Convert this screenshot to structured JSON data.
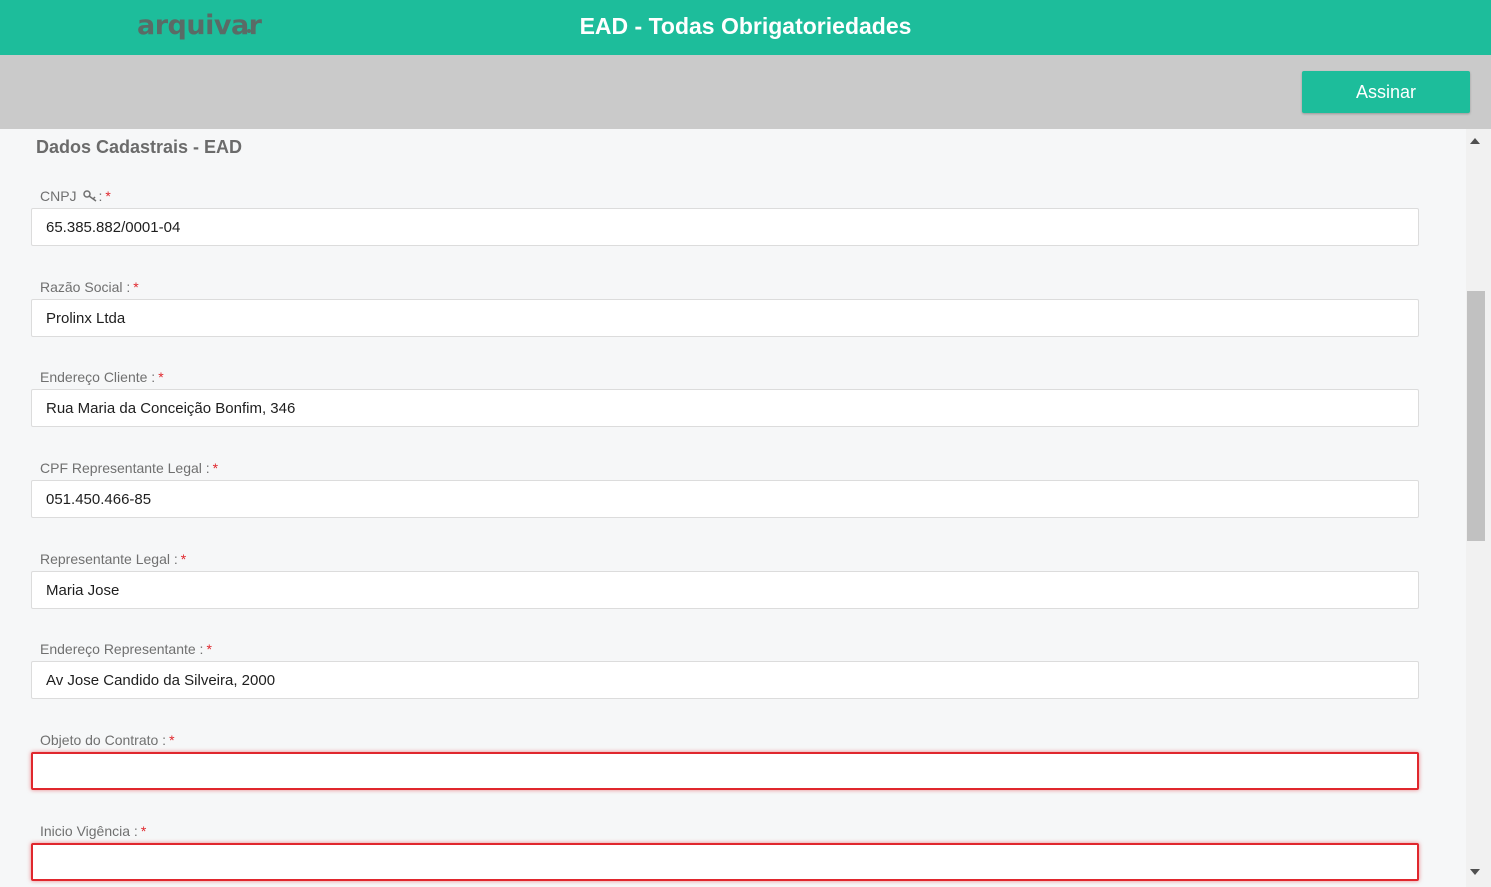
{
  "header": {
    "logo_text": "arquivar",
    "title": "EAD - Todas Obrigatoriedades",
    "colors": {
      "primary": "#1dbd9b",
      "logo": "#5a6b66",
      "error": "#e0272d"
    }
  },
  "toolbar": {
    "sign_label": "Assinar"
  },
  "form": {
    "section_title": "Dados Cadastrais - EAD",
    "required_mark": "*",
    "fields": [
      {
        "label": "CNPJ",
        "suffix": ":",
        "value": "65.385.882/0001-04",
        "icon": "key-icon"
      },
      {
        "label": "Razão Social :",
        "value": "Prolinx Ltda"
      },
      {
        "label": "Endereço Cliente :",
        "value": "Rua Maria da Conceição Bonfim, 346"
      },
      {
        "label": "CPF Representante Legal :",
        "value": "051.450.466-85"
      },
      {
        "label": "Representante Legal :",
        "value": "Maria Jose"
      },
      {
        "label": "Endereço Representante :",
        "value": "Av Jose Candido da Silveira, 2000"
      },
      {
        "label": "Objeto do Contrato :",
        "value": "",
        "state": "error"
      },
      {
        "label": "Inicio Vigência :",
        "value": "",
        "state": "error"
      }
    ]
  }
}
